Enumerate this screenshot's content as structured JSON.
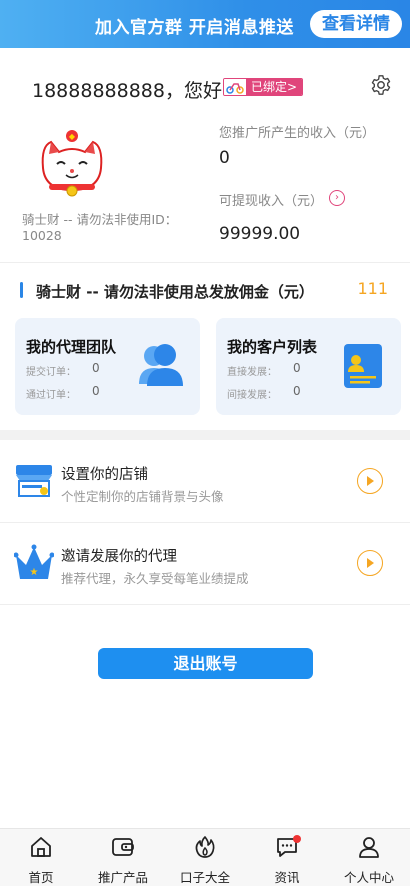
{
  "banner": {
    "text": "加入官方群  开启消息推送",
    "button": "查看详情"
  },
  "profile": {
    "greeting": "18888888888，您好",
    "bound_badge": "已绑定>",
    "nickname": "骑士财 -- 请勿法非使用ID：10028",
    "income_label": "您推广所产生的收入（元）",
    "income_value": "0",
    "withdraw_label": "可提现收入（元）",
    "withdraw_value": "99999.00"
  },
  "commission": {
    "title": "骑士财 -- 请勿法非使用总发放佣金（元）",
    "value": "111"
  },
  "cards": {
    "team": {
      "title": "我的代理团队",
      "row1_label": "提交订单：",
      "row1_value": "0",
      "row2_label": "通过订单：",
      "row2_value": "0"
    },
    "customers": {
      "title": "我的客户列表",
      "row1_label": "直接发展：",
      "row1_value": "0",
      "row2_label": "间接发展：",
      "row2_value": "0"
    }
  },
  "list": [
    {
      "title": "设置你的店铺",
      "subtitle": "个性定制你的店铺背景与头像",
      "icon": "shop-icon"
    },
    {
      "title": "邀请发展你的代理",
      "subtitle": "推荐代理，永久享受每笔业绩提成",
      "icon": "crown-icon"
    }
  ],
  "logout": "退出账号",
  "tabs": [
    {
      "label": "首页",
      "icon": "home-icon"
    },
    {
      "label": "推广产品",
      "icon": "wallet-icon"
    },
    {
      "label": "口子大全",
      "icon": "fire-icon"
    },
    {
      "label": "资讯",
      "icon": "message-icon"
    },
    {
      "label": "个人中心",
      "icon": "user-icon"
    }
  ],
  "colors": {
    "primary": "#2a86e6",
    "accent": "#f5a623",
    "pink": "#e0457b"
  }
}
